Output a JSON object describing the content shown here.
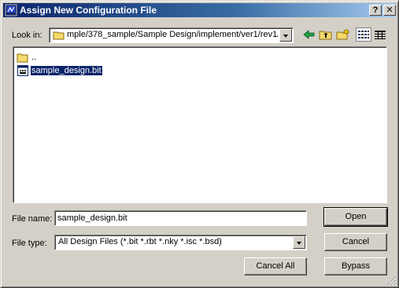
{
  "window": {
    "title": "Assign New Configuration File",
    "help_label": "?",
    "close_label": "✕"
  },
  "lookin": {
    "label": "Look in:",
    "path": "mple/378_sample/Sample Design/implement/ver1/rev1/"
  },
  "toolbar": {
    "icons": [
      "back-arrow-icon",
      "up-folder-icon",
      "new-folder-icon",
      "list-view-icon",
      "details-view-icon"
    ]
  },
  "files": [
    {
      "name": "..",
      "icon": "folder-icon",
      "selected": false
    },
    {
      "name": "sample_design.bit",
      "icon": "bit-file-icon",
      "selected": true
    }
  ],
  "filename": {
    "label": "File name:",
    "value": "sample_design.bit"
  },
  "filetype": {
    "label": "File type:",
    "value": "All Design Files (*.bit *.rbt *.nky *.isc *.bsd)"
  },
  "buttons": {
    "open": "Open",
    "cancel": "Cancel",
    "cancel_all": "Cancel All",
    "bypass": "Bypass"
  },
  "colors": {
    "title_bar": "#0a246a",
    "selection": "#0a246a",
    "dialog_face": "#d4d0c8"
  }
}
